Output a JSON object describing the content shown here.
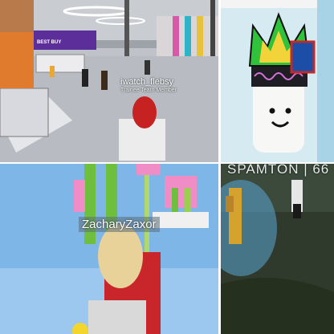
{
  "panels": {
    "top_left": {
      "player_name": "iwatch_flebsy",
      "player_role": "Trainee Team Member",
      "store_sign": "BEST BUY"
    },
    "top_right": {},
    "bottom_left": {
      "player_name": "ZacharyZaxor"
    },
    "bottom_right": {
      "player_name": "SPAMTON | 66"
    }
  },
  "colors": {
    "store_floor": "#b8bcc2",
    "store_accent": "#7a3fbf",
    "crown_green": "#2fc23a",
    "sky_blue": "#7fb6e8",
    "grass_dark": "#2f3a2c"
  }
}
